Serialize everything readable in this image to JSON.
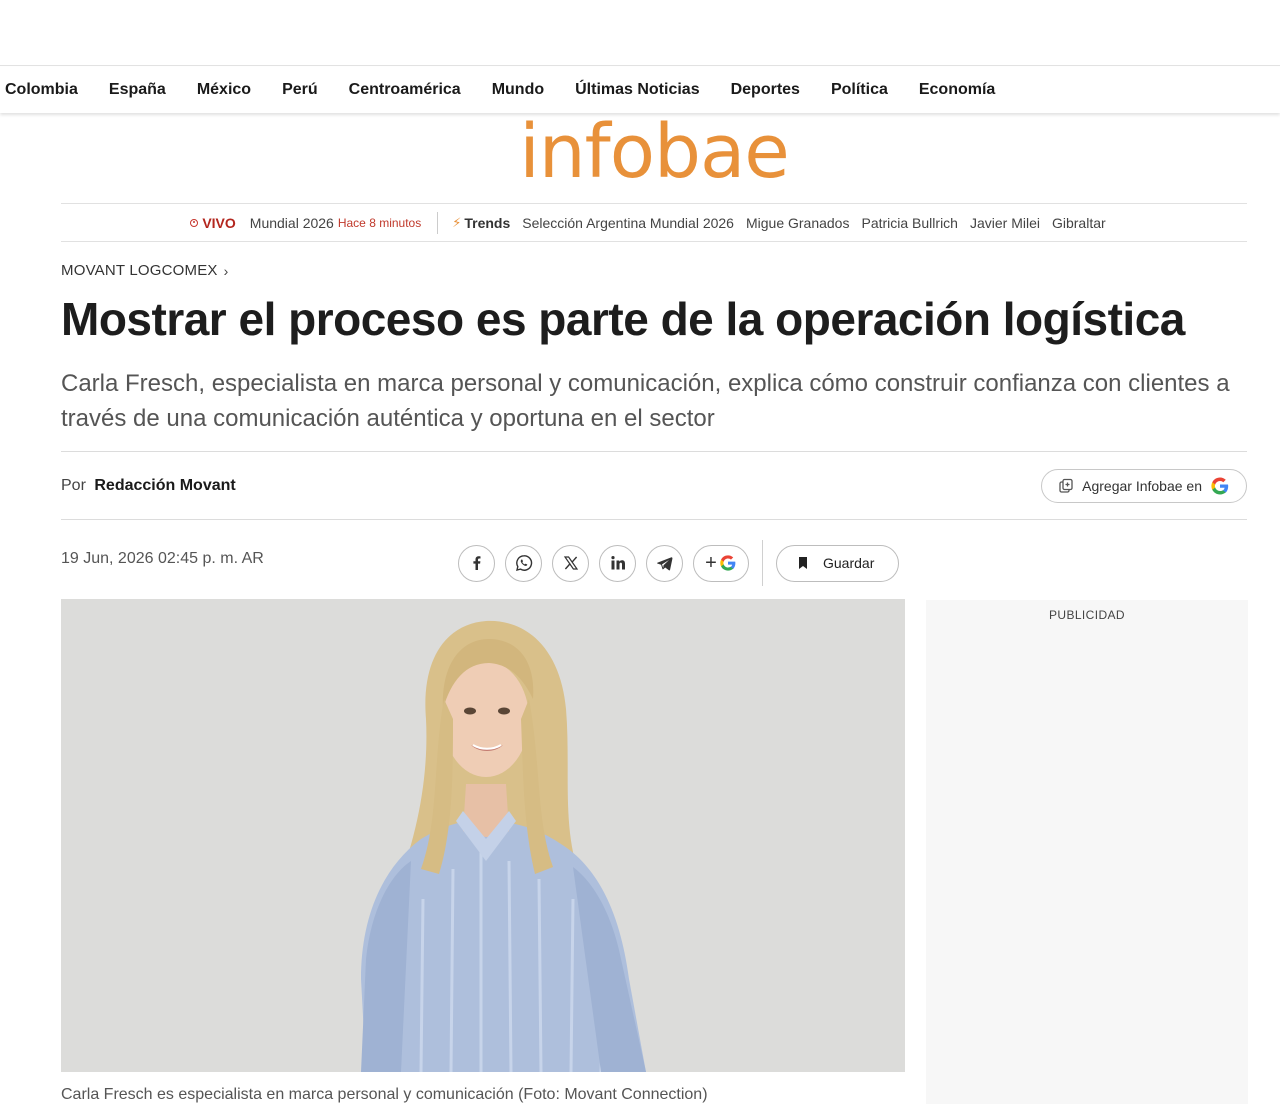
{
  "nav": {
    "items": [
      "Colombia",
      "España",
      "México",
      "Perú",
      "Centroamérica",
      "Mundo",
      "Últimas Noticias",
      "Deportes",
      "Política",
      "Economía"
    ]
  },
  "logo": {
    "text": "infobae",
    "color": "#e8913a"
  },
  "trends": {
    "live_label": "VIVO",
    "live_topic": "Mundial 2026",
    "live_time": "Hace 8 minutos",
    "label": "Trends",
    "items": [
      "Selección Argentina Mundial 2026",
      "Migue Granados",
      "Patricia Bullrich",
      "Javier Milei",
      "Gibraltar"
    ]
  },
  "article": {
    "kicker": "MOVANT LOGCOMEX",
    "title": "Mostrar el proceso es parte de la operación logística",
    "subtitle": "Carla Fresch, especialista en marca personal y comunicación, explica cómo construir confianza con clientes a través de una comunicación auténtica y oportuna en el sector",
    "byline_prefix": "Por",
    "author": "Redacción Movant",
    "date": "19 Jun, 2026 02:45 p. m. AR",
    "caption": "Carla Fresch es especialista en marca personal y comunicación (Foto: Movant Connection)"
  },
  "actions": {
    "add_infobae_label": "Agregar Infobae en",
    "save_label": "Guardar",
    "share_icons": [
      "facebook-icon",
      "whatsapp-icon",
      "x-icon",
      "linkedin-icon",
      "telegram-icon",
      "google-plus-icon"
    ]
  },
  "ad": {
    "label": "PUBLICIDAD"
  }
}
